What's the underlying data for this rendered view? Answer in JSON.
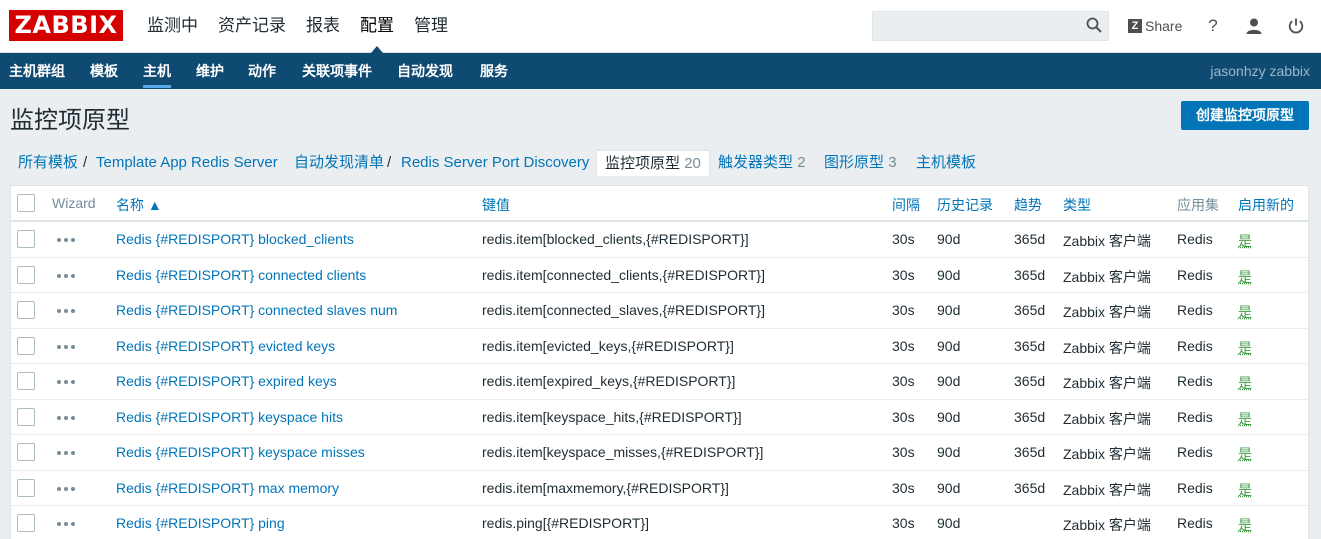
{
  "app": {
    "logo": "ZABBIX",
    "user": "jasonhzy zabbix"
  },
  "topbar": {
    "menu": [
      "监测中",
      "资产记录",
      "报表",
      "配置",
      "管理"
    ],
    "active_menu": "配置",
    "search_value": "",
    "share_label": "Share",
    "help_glyph": "?"
  },
  "subnav": {
    "items": [
      "主机群组",
      "模板",
      "主机",
      "维护",
      "动作",
      "关联项事件",
      "自动发现",
      "服务"
    ],
    "active": "主机"
  },
  "page": {
    "title": "监控项原型",
    "create_button": "创建监控项原型"
  },
  "breadcrumb": {
    "all_templates": "所有模板",
    "separator": "/",
    "template": "Template App Redis Server",
    "discovery_list": "自动发现清单",
    "discovery_rule": "Redis Server Port Discovery",
    "tabs": [
      {
        "label": "监控项原型",
        "count": "20"
      },
      {
        "label": "触发器类型",
        "count": "2"
      },
      {
        "label": "图形原型",
        "count": "3"
      },
      {
        "label": "主机模板",
        "count": ""
      }
    ]
  },
  "table": {
    "headers": {
      "wizard": "Wizard",
      "name": "名称 ▲",
      "key": "键值",
      "interval": "间隔",
      "history": "历史记录",
      "trends": "趋势",
      "type": "类型",
      "applications": "应用集",
      "create_enabled": "启用新的"
    },
    "rows": [
      {
        "name": "Redis {#REDISPORT} blocked_clients",
        "key": "redis.item[blocked_clients,{#REDISPORT}]",
        "interval": "30s",
        "history": "90d",
        "trends": "365d",
        "type": "Zabbix 客户端",
        "app": "Redis",
        "enabled": "是"
      },
      {
        "name": "Redis {#REDISPORT} connected clients",
        "key": "redis.item[connected_clients,{#REDISPORT}]",
        "interval": "30s",
        "history": "90d",
        "trends": "365d",
        "type": "Zabbix 客户端",
        "app": "Redis",
        "enabled": "是"
      },
      {
        "name": "Redis {#REDISPORT} connected slaves num",
        "key": "redis.item[connected_slaves,{#REDISPORT}]",
        "interval": "30s",
        "history": "90d",
        "trends": "365d",
        "type": "Zabbix 客户端",
        "app": "Redis",
        "enabled": "是"
      },
      {
        "name": "Redis {#REDISPORT} evicted keys",
        "key": "redis.item[evicted_keys,{#REDISPORT}]",
        "interval": "30s",
        "history": "90d",
        "trends": "365d",
        "type": "Zabbix 客户端",
        "app": "Redis",
        "enabled": "是"
      },
      {
        "name": "Redis {#REDISPORT} expired keys",
        "key": "redis.item[expired_keys,{#REDISPORT}]",
        "interval": "30s",
        "history": "90d",
        "trends": "365d",
        "type": "Zabbix 客户端",
        "app": "Redis",
        "enabled": "是"
      },
      {
        "name": "Redis {#REDISPORT} keyspace hits",
        "key": "redis.item[keyspace_hits,{#REDISPORT}]",
        "interval": "30s",
        "history": "90d",
        "trends": "365d",
        "type": "Zabbix 客户端",
        "app": "Redis",
        "enabled": "是"
      },
      {
        "name": "Redis {#REDISPORT} keyspace misses",
        "key": "redis.item[keyspace_misses,{#REDISPORT}]",
        "interval": "30s",
        "history": "90d",
        "trends": "365d",
        "type": "Zabbix 客户端",
        "app": "Redis",
        "enabled": "是"
      },
      {
        "name": "Redis {#REDISPORT} max memory",
        "key": "redis.item[maxmemory,{#REDISPORT}]",
        "interval": "30s",
        "history": "90d",
        "trends": "365d",
        "type": "Zabbix 客户端",
        "app": "Redis",
        "enabled": "是"
      },
      {
        "name": "Redis {#REDISPORT} ping",
        "key": "redis.ping[{#REDISPORT}]",
        "interval": "30s",
        "history": "90d",
        "trends": "",
        "type": "Zabbix 客户端",
        "app": "Redis",
        "enabled": "是"
      }
    ]
  },
  "colors": {
    "brand_red": "#d40000",
    "nav_blue": "#0e4a72",
    "link_blue": "#0275b8",
    "enabled_green": "#429e47"
  }
}
